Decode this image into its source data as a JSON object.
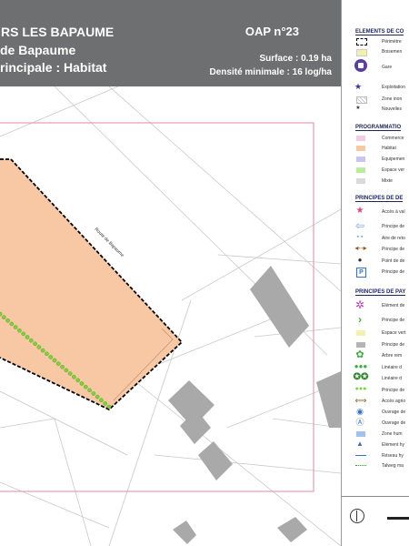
{
  "header": {
    "title_line1": "RS LES BAPAUME",
    "title_line2": "de Bapaume",
    "title_line3": "rincipale : Habitat",
    "oap_label": "OAP n°23",
    "surface": "Surface : 0.19 ha",
    "densite": "Densité minimale : 16 log/ha"
  },
  "map": {
    "road_label": "Route de Bapaume",
    "colors": {
      "habitat": "#f8c7a4",
      "perimeter": "#000000",
      "border": "#e58aa0",
      "building": "#a9a9a9",
      "hedge": "#7cd23b"
    }
  },
  "legend": {
    "sections": [
      {
        "title": "ELEMENTS DE CO",
        "items": [
          {
            "icon": "perimeter-dashed-icon",
            "label": "Périmètre"
          },
          {
            "icon": "boisement-swatch",
            "label": "Boisemen",
            "color": "#f3f0b0"
          },
          {
            "icon": "train-station-icon",
            "label": "Gare",
            "color": "#5a3ea3"
          },
          {
            "icon": "star-icon",
            "label": "Exploitation",
            "color": "#3333aa"
          },
          {
            "icon": "zone-hatch-icon",
            "label": "Zone inon"
          },
          {
            "icon": "star-small-icon",
            "label": "Nouvelles"
          }
        ]
      },
      {
        "title": "PROGRAMMATIO",
        "items": [
          {
            "icon": "swatch",
            "label": "Commerce",
            "color": "#f5cde3"
          },
          {
            "icon": "swatch",
            "label": "Habitat",
            "color": "#f8c7a4"
          },
          {
            "icon": "swatch",
            "label": "Equipemen",
            "color": "#c9c4f2"
          },
          {
            "icon": "swatch",
            "label": "Espace ver",
            "color": "#b9ef9c"
          },
          {
            "icon": "swatch",
            "label": "Mixte",
            "color": "#d9d9d9"
          }
        ]
      },
      {
        "title": "PRINCIPES DE DE",
        "items": [
          {
            "icon": "access-star-icon",
            "label": "Accès à val",
            "color": "#e0457b"
          },
          {
            "icon": "arrow-left-icon",
            "label": "Principe de",
            "color": "#6ba5e8"
          },
          {
            "icon": "dotted-line-icon",
            "label": "Aire de reto",
            "color": "#6ba5e8"
          },
          {
            "icon": "double-arrow-icon",
            "label": "Principe de",
            "color": "#8a5a1a"
          },
          {
            "icon": "point-icon",
            "label": "Point de de",
            "color": "#333333"
          },
          {
            "icon": "parking-icon",
            "label": "Principe de",
            "color": "#3a6fc6"
          }
        ]
      },
      {
        "title": "PRINCIPES DE PAY",
        "items": [
          {
            "icon": "flower-icon",
            "label": "Elément de",
            "color": "#c03cb8"
          },
          {
            "icon": "chevron-right-icon",
            "label": "Principe de",
            "color": "#3ab03a"
          },
          {
            "icon": "swatch",
            "label": "Espace vert",
            "color": "#f3f0b0"
          },
          {
            "icon": "swatch",
            "label": "Principe de",
            "color": "#b5b5b5"
          },
          {
            "icon": "tree-icon",
            "label": "Arbre rem",
            "color": "#3ab03a"
          },
          {
            "icon": "hedge-icon",
            "label": "Linéaire d",
            "color": "#3ab03a"
          },
          {
            "icon": "double-tree-icon",
            "label": "Linéaire d",
            "color": "#2e8a2e"
          },
          {
            "icon": "dots-icon",
            "label": "Principe de",
            "color": "#7cd23b"
          },
          {
            "icon": "double-arrow-icon",
            "label": "Accès agrio",
            "color": "#8a5a1a"
          },
          {
            "icon": "circle-icon",
            "label": "Ouvrage de",
            "color": "#3a6fc6"
          },
          {
            "icon": "circle-a-icon",
            "label": "Ouvrage de",
            "color": "#3a6fc6"
          },
          {
            "icon": "swatch",
            "label": "Zone hum",
            "color": "#9ec3ef"
          },
          {
            "icon": "triangle-icon",
            "label": "Elément hy",
            "color": "#3a6fc6"
          },
          {
            "icon": "line-icon",
            "label": "Réseau hy",
            "color": "#3a6fc6"
          },
          {
            "icon": "dotted-line-icon",
            "label": "Talweg ma",
            "color": "#3a9a3a"
          }
        ]
      }
    ]
  }
}
